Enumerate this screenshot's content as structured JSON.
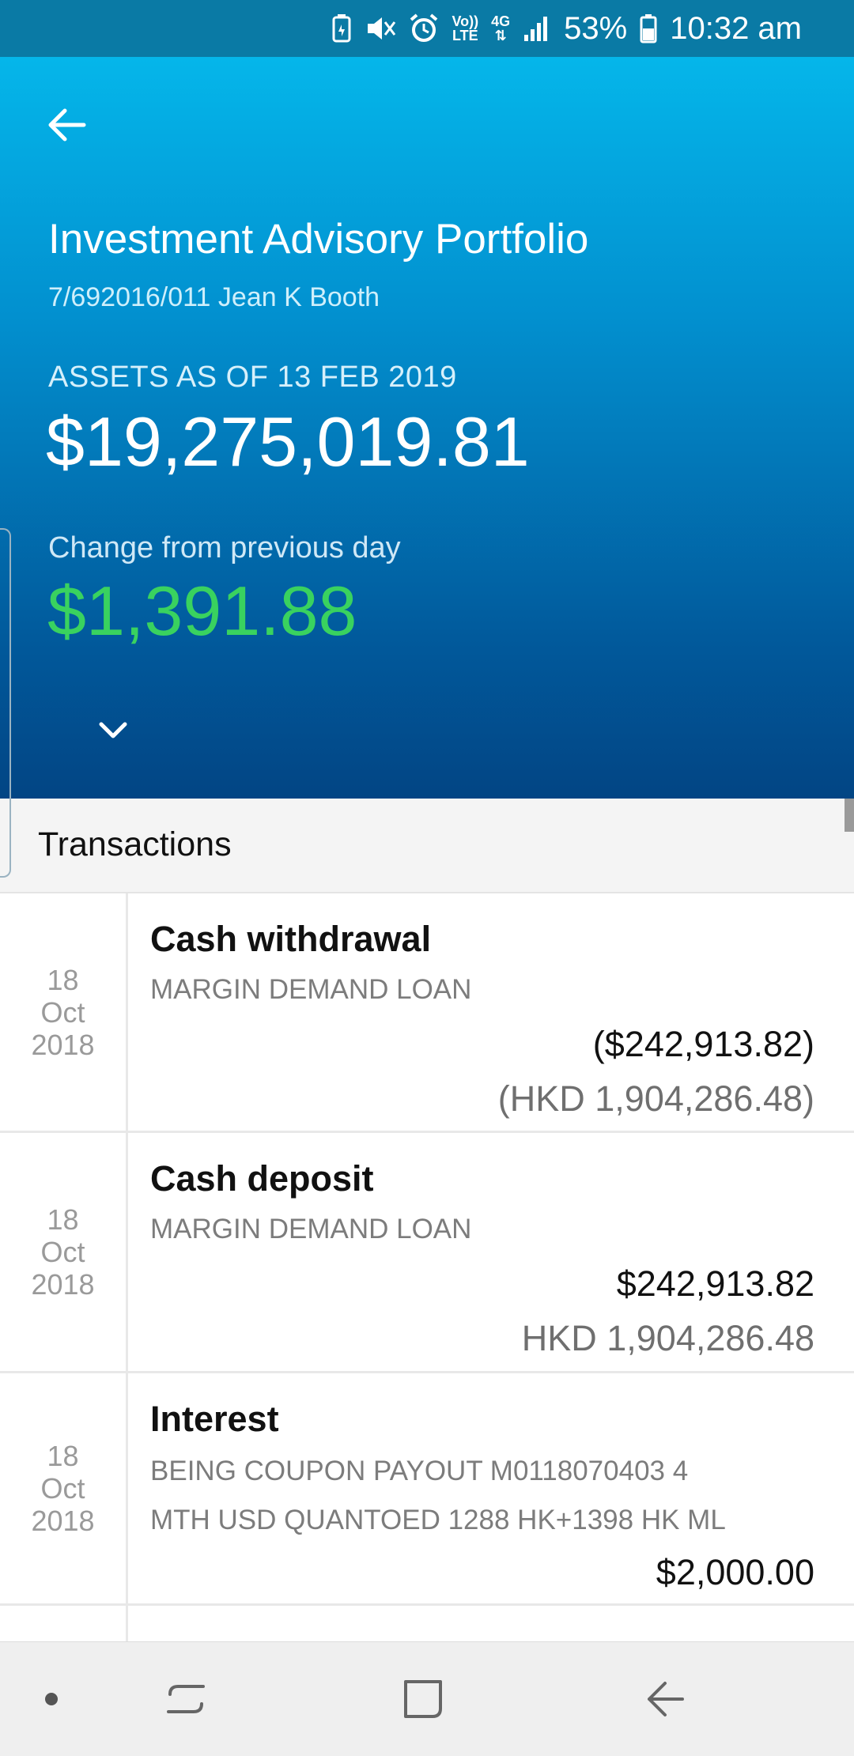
{
  "status_bar": {
    "volte_top": "Vo))",
    "volte_bottom": "LTE",
    "network": "4G",
    "battery": "53%",
    "time": "10:32 am"
  },
  "header": {
    "title": "Investment Advisory Portfolio",
    "account": "7/692016/011 Jean K Booth",
    "assets_label": "ASSETS AS OF 13 FEB 2019",
    "assets_value": "$19,275,019.81",
    "change_label": "Change from previous day",
    "change_value": "$1,391.88",
    "change_color": "#39d25f"
  },
  "transactions": {
    "title": "Transactions",
    "items": [
      {
        "day": "18",
        "month": "Oct",
        "year": "2018",
        "type": "Cash withdrawal",
        "desc1": "MARGIN DEMAND LOAN",
        "desc2": "",
        "amount": "($242,913.82)",
        "amount_local": "(HKD 1,904,286.48)"
      },
      {
        "day": "18",
        "month": "Oct",
        "year": "2018",
        "type": "Cash deposit",
        "desc1": "MARGIN DEMAND LOAN",
        "desc2": "",
        "amount": "$242,913.82",
        "amount_local": "HKD 1,904,286.48"
      },
      {
        "day": "18",
        "month": "Oct",
        "year": "2018",
        "type": "Interest",
        "desc1": "BEING COUPON PAYOUT M0118070403  4",
        "desc2": "MTH USD QUANTOED 1288 HK+1398 HK ML",
        "amount": "$2,000.00",
        "amount_local": ""
      }
    ]
  },
  "nav": {
    "icons": [
      "dot-icon",
      "recent-apps-icon",
      "home-icon",
      "back-icon"
    ]
  }
}
